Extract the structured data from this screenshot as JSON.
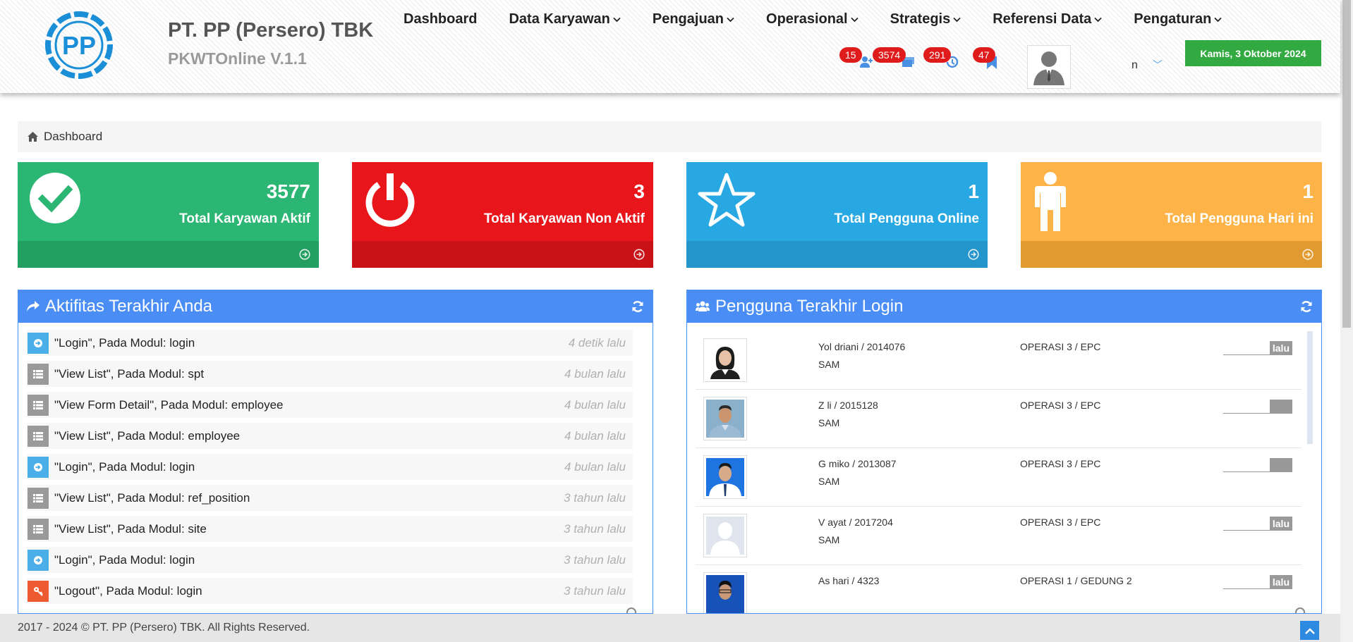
{
  "header": {
    "logo_text": "PP",
    "company_name": "PT. PP (Persero) TBK",
    "app_version": "PKWTOnline V.1.1",
    "date": "Kamis, 3 Oktober 2024",
    "user_name": "n"
  },
  "nav": [
    {
      "label": "Dashboard",
      "dropdown": false
    },
    {
      "label": "Data Karyawan",
      "dropdown": true
    },
    {
      "label": "Pengajuan",
      "dropdown": true
    },
    {
      "label": "Operasional",
      "dropdown": true
    },
    {
      "label": "Strategis",
      "dropdown": true
    },
    {
      "label": "Referensi Data",
      "dropdown": true
    },
    {
      "label": "Pengaturan",
      "dropdown": true
    }
  ],
  "notifications": [
    {
      "count": "15",
      "icon": "user-add-icon"
    },
    {
      "count": "3574",
      "icon": "layers-icon"
    },
    {
      "count": "291",
      "icon": "history-icon"
    },
    {
      "count": "47",
      "icon": "bookmark-icon"
    }
  ],
  "breadcrumb": {
    "label": "Dashboard"
  },
  "tiles": [
    {
      "value": "3577",
      "label": "Total Karyawan Aktif",
      "color": "#2bb673",
      "color_dark": "#239f62",
      "icon": "check-circle-icon"
    },
    {
      "value": "3",
      "label": "Total Karyawan Non Aktif",
      "color": "#e8161b",
      "color_dark": "#c81217",
      "icon": "power-icon"
    },
    {
      "value": "1",
      "label": "Total Pengguna Online",
      "color": "#28a8e3",
      "color_dark": "#2395ca",
      "icon": "star-icon"
    },
    {
      "value": "1",
      "label": "Total Pengguna Hari ini",
      "color": "#fdb347",
      "color_dark": "#e09a30",
      "icon": "person-icon"
    }
  ],
  "activity": {
    "title": "Aktifitas Terakhir Anda",
    "items": [
      {
        "text": "\"Login\", Pada Modul: login",
        "time": "4 detik lalu",
        "type": "login",
        "color": "#4aaee8"
      },
      {
        "text": "\"View List\", Pada Modul: spt",
        "time": "4 bulan lalu",
        "type": "list",
        "color": "#9a9a9a"
      },
      {
        "text": "\"View Form Detail\", Pada Modul: employee",
        "time": "4 bulan lalu",
        "type": "list",
        "color": "#9a9a9a"
      },
      {
        "text": "\"View List\", Pada Modul: employee",
        "time": "4 bulan lalu",
        "type": "list",
        "color": "#9a9a9a"
      },
      {
        "text": "\"Login\", Pada Modul: login",
        "time": "4 bulan lalu",
        "type": "login",
        "color": "#4aaee8"
      },
      {
        "text": "\"View List\", Pada Modul: ref_position",
        "time": "3 tahun lalu",
        "type": "list",
        "color": "#9a9a9a"
      },
      {
        "text": "\"View List\", Pada Modul: site",
        "time": "3 tahun lalu",
        "type": "list",
        "color": "#9a9a9a"
      },
      {
        "text": "\"Login\", Pada Modul: login",
        "time": "3 tahun lalu",
        "type": "login",
        "color": "#4aaee8"
      },
      {
        "text": "\"Logout\", Pada Modul: login",
        "time": "3 tahun lalu",
        "type": "logout",
        "color": "#ee5a30"
      }
    ]
  },
  "users": {
    "title": "Pengguna Terakhir Login",
    "rows": [
      {
        "name": "Yol       driani / 2014076",
        "site": "SAM",
        "unit": "OPERASI 3 / EPC",
        "time": "lalu"
      },
      {
        "name": "Z        li / 2015128",
        "site": "SAM",
        "unit": "OPERASI 3 / EPC",
        "time": ""
      },
      {
        "name": "G          miko / 2013087",
        "site": "SAM",
        "unit": "OPERASI 3 / EPC",
        "time": ""
      },
      {
        "name": "V          ayat / 2017204",
        "site": "SAM",
        "unit": "OPERASI 3 / EPC",
        "time": "lalu"
      },
      {
        "name": "As         hari / 4323",
        "site": "",
        "unit": "OPERASI 1 / GEDUNG 2",
        "time": "lalu"
      }
    ]
  },
  "footer": {
    "text": "2017 - 2024 © PT. PP (Persero) TBK. All Rights Reserved."
  }
}
